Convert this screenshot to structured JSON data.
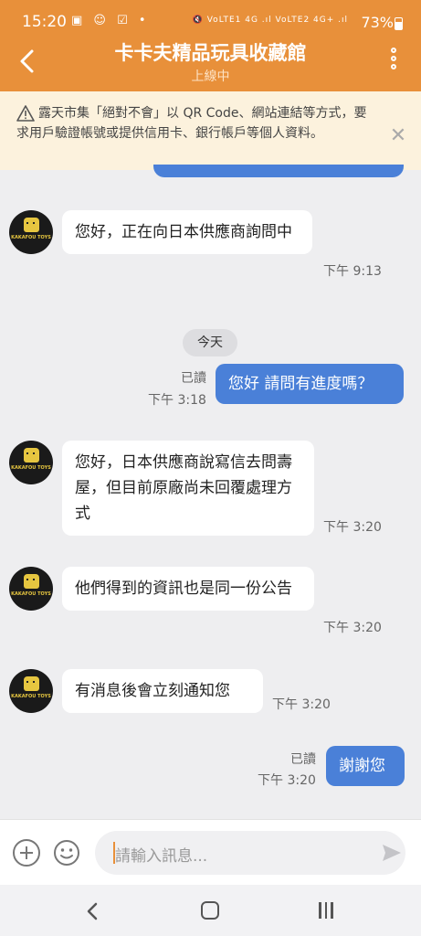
{
  "status_bar": {
    "time": "15:20",
    "left_icons": "▣ ☺ ☑ •",
    "right_icons": "🔇 VoLTE1 4G .ıl VoLTE2 4G+ .ıl",
    "battery": "73%"
  },
  "header": {
    "title": "卡卡夫精品玩具收藏館",
    "status": "上線中"
  },
  "notice": {
    "text": "露天市集「絕對不會」以 QR Code、網站連結等方式，要求用戶驗證帳號或提供信用卡、銀行帳戶等個人資料。"
  },
  "avatar": {
    "logo_text": "KAKAFOU TOYS"
  },
  "messages": [
    {
      "text": "您好，正在向日本供應商詢問中",
      "time": "下午 9:13"
    },
    {
      "text": "您好 請問有進度嗎？",
      "read": "已讀",
      "time": "下午 3:18"
    },
    {
      "text": "您好，日本供應商說寫信去問壽屋，但目前原廠尚未回覆處理方式",
      "time": "下午 3:20"
    },
    {
      "text": "他們得到的資訊也是同一份公告",
      "time": "下午 3:20"
    },
    {
      "text": "有消息後會立刻通知您",
      "time": "下午 3:20"
    },
    {
      "text": "謝謝您",
      "read": "已讀",
      "time": "下午 3:20"
    }
  ],
  "date_divider": "今天",
  "input": {
    "placeholder": "請輸入訊息..."
  },
  "colors": {
    "brand_orange": "#e8903a",
    "outgoing_bubble": "#4a80d8",
    "notice_bg": "#fcf2dd",
    "chat_bg": "#eeeef0"
  },
  "icons": {
    "back": "chevron-left-icon",
    "menu": "more-vertical-icon",
    "warning": "warning-triangle-icon",
    "close": "close-icon",
    "plus": "plus-circle-icon",
    "emoji": "emoji-icon",
    "send": "send-icon"
  }
}
